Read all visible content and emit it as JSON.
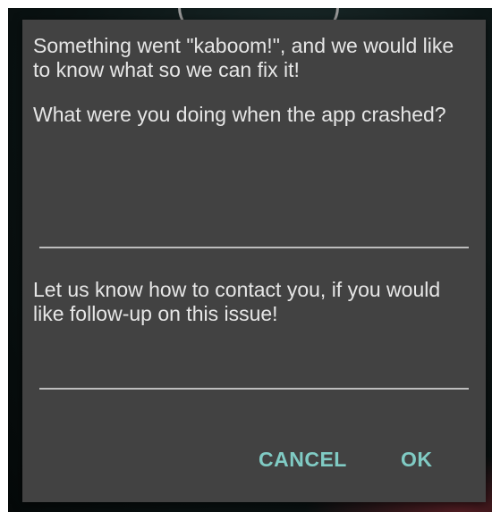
{
  "dialog": {
    "intro": "Something went \"kaboom!\", and we would like to know what so we can fix it!",
    "crash_question": "What were you doing when the app crashed?",
    "crash_field_value": "",
    "contact_prompt": "Let us know how to contact you, if you would like follow-up on this issue!",
    "contact_field_value": "",
    "cancel_label": "CANCEL",
    "ok_label": "OK"
  },
  "colors": {
    "dialog_background": "#424242",
    "text": "#e6e6e6",
    "accent": "#80cbc4",
    "field_underline": "#bdbdbd"
  }
}
